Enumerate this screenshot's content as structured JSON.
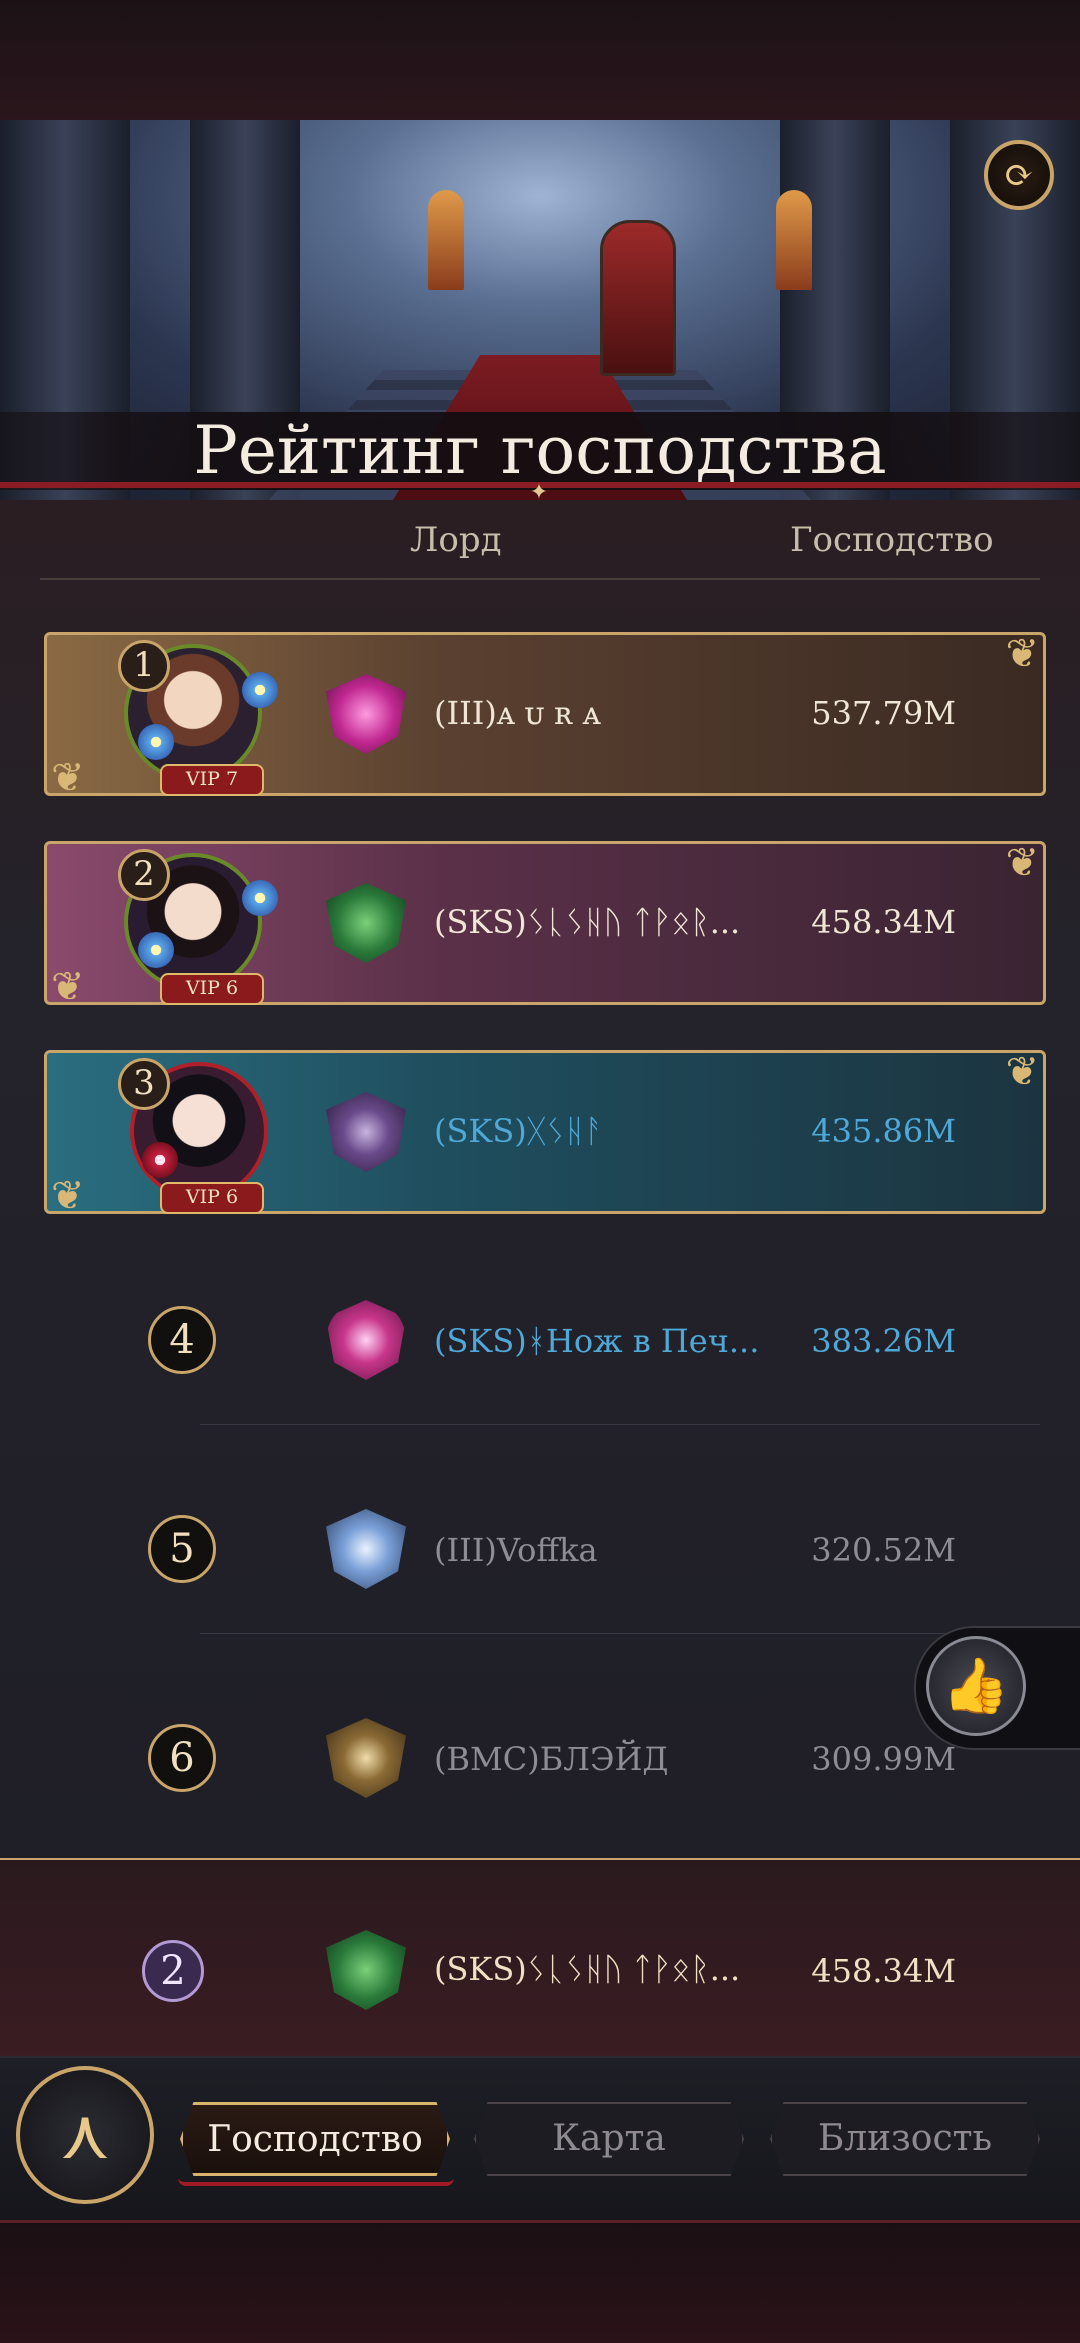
{
  "header": {
    "title": "Рейтинг господства",
    "refresh_icon": "refresh-icon"
  },
  "columns": {
    "lord": "Лорд",
    "dominance": "Господство"
  },
  "rankings": [
    {
      "rank": "1",
      "vip": "VIP 7",
      "name": "(III)ᴀ ᴜ ʀ ᴀ",
      "score": "537.79M",
      "name_color": "#f0e6d6",
      "score_color": "#f0e6d6"
    },
    {
      "rank": "2",
      "vip": "VIP 6",
      "name": "(SKS)ᛊᚳᛊᚺᚢ ᛏᚹᛟᚱ...",
      "score": "458.34M",
      "name_color": "#f0e6d6",
      "score_color": "#f0e6d6"
    },
    {
      "rank": "3",
      "vip": "VIP 6",
      "name": "(SKS)ᚷᛊᚺᚨ",
      "score": "435.86M",
      "name_color": "#4ea8d8",
      "score_color": "#4ea8d8"
    },
    {
      "rank": "4",
      "name": "(SKS)ᚼНож в Печ...",
      "score": "383.26M",
      "name_color": "#4ea8d8",
      "score_color": "#4ea8d8"
    },
    {
      "rank": "5",
      "name": "(III)Voffka",
      "score": "320.52M",
      "name_color": "#8e8c94",
      "score_color": "#8e8c94"
    },
    {
      "rank": "6",
      "name": "(BMC)БЛЭЙД",
      "score": "309.99M",
      "name_color": "#8e8c94",
      "score_color": "#8e8c94"
    }
  ],
  "my_rank": {
    "rank": "2",
    "name": "(SKS)ᛊᚳᛊᚺᚢ ᛏᚹᛟᚱ...",
    "score": "458.34M"
  },
  "tabs": [
    {
      "label": "Господство",
      "active": true
    },
    {
      "label": "Карта",
      "active": false
    },
    {
      "label": "Близость",
      "active": false
    }
  ],
  "like_icon": "thumbs-up-icon",
  "menu_icon": "emblem-menu-icon"
}
